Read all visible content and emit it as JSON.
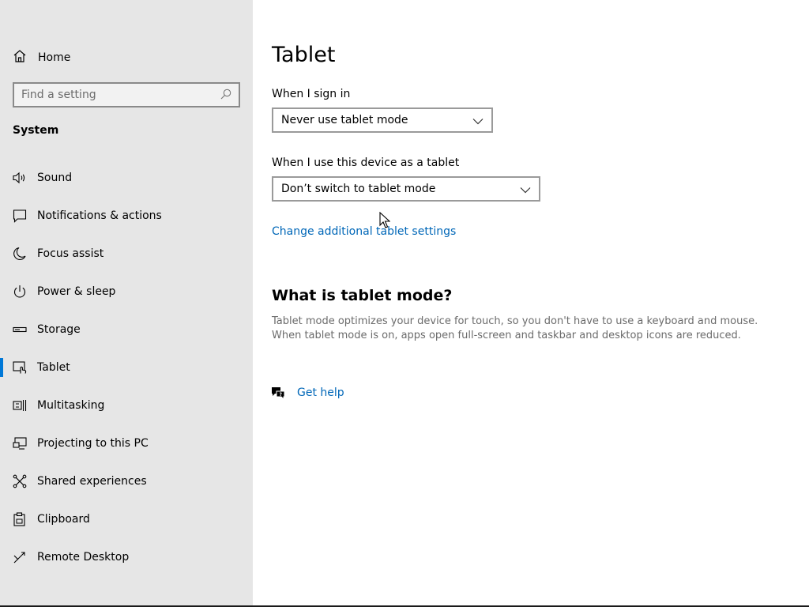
{
  "sidebar": {
    "home_label": "Home",
    "search_placeholder": "Find a setting",
    "section_title": "System",
    "items": [
      {
        "label": "Sound",
        "icon": "speaker-icon"
      },
      {
        "label": "Notifications & actions",
        "icon": "message-icon"
      },
      {
        "label": "Focus assist",
        "icon": "moon-icon"
      },
      {
        "label": "Power & sleep",
        "icon": "power-icon"
      },
      {
        "label": "Storage",
        "icon": "storage-icon"
      },
      {
        "label": "Tablet",
        "icon": "tablet-icon",
        "selected": true
      },
      {
        "label": "Multitasking",
        "icon": "multitasking-icon"
      },
      {
        "label": "Projecting to this PC",
        "icon": "projector-icon"
      },
      {
        "label": "Shared experiences",
        "icon": "share-icon"
      },
      {
        "label": "Clipboard",
        "icon": "clipboard-icon"
      },
      {
        "label": "Remote Desktop",
        "icon": "remote-icon"
      }
    ]
  },
  "main": {
    "title": "Tablet",
    "sign_in": {
      "label": "When I sign in",
      "value": "Never use tablet mode"
    },
    "device_tablet": {
      "label": "When I use this device as a tablet",
      "value": "Don’t switch to tablet mode"
    },
    "additional_link": "Change additional tablet settings",
    "what_is_heading": "What is tablet mode?",
    "description": "Tablet mode optimizes your device for touch, so you don't have to use a keyboard and mouse. When tablet mode is on, apps open full-screen and taskbar and desktop icons are reduced.",
    "help_link": "Get help"
  },
  "colors": {
    "accent": "#0078d7",
    "link": "#0067b8",
    "sidebar_bg": "#e6e6e6"
  }
}
